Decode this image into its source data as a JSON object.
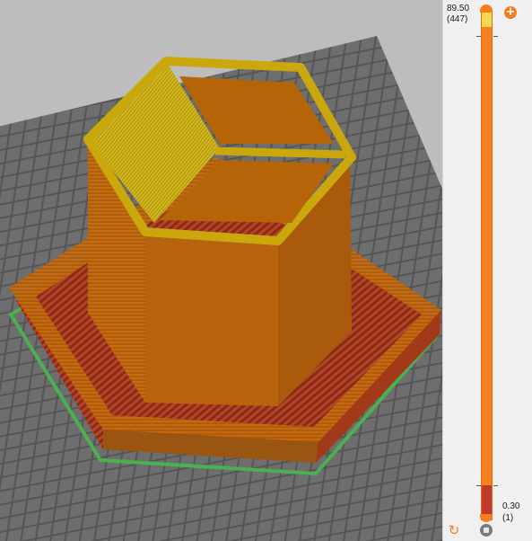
{
  "viewport": {
    "description_icon": "3d-print-preview",
    "colors": {
      "bed_dark": "#4a4a4a",
      "bed_light": "#6f6f6f",
      "perimeter": "#f5a000",
      "infill_orange": "#b8610a",
      "solid_infill": "#a63d1e",
      "skirt": "#4caf50",
      "top_surface": "#d4b814"
    }
  },
  "layer_slider": {
    "top_value": "89.50",
    "top_layer": "(447)",
    "bottom_value": "0.30",
    "bottom_layer": "(1)",
    "upper_fraction": 1.0,
    "lower_fraction": 0.0,
    "add_icon": "plus-circle-icon",
    "reset_icon": "undo-icon",
    "settings_icon": "cog-icon"
  }
}
